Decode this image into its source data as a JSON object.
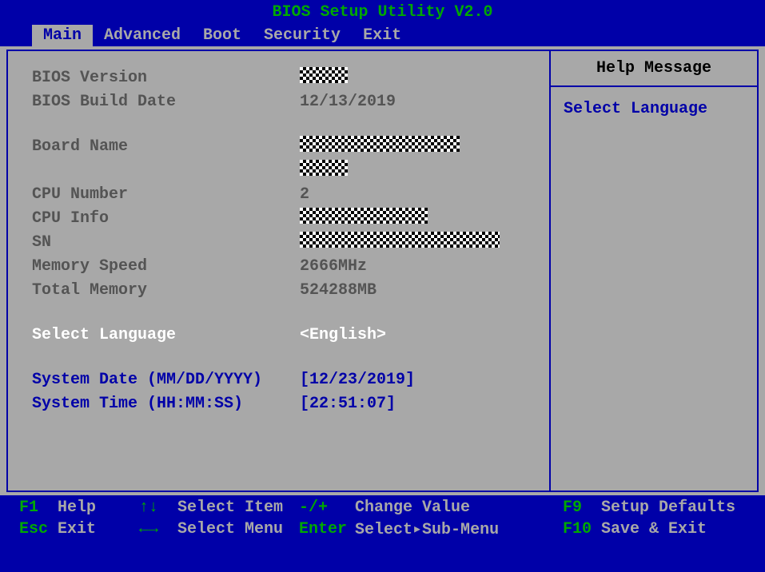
{
  "header": {
    "title": "BIOS Setup Utility V2.0"
  },
  "tabs": [
    {
      "label": "Main",
      "active": true
    },
    {
      "label": "Advanced",
      "active": false
    },
    {
      "label": "Boot",
      "active": false
    },
    {
      "label": "Security",
      "active": false
    },
    {
      "label": "Exit",
      "active": false
    }
  ],
  "main": {
    "bios_version_label": "BIOS Version",
    "bios_build_date_label": "BIOS Build Date",
    "bios_build_date_value": "12/13/2019",
    "board_name_label": "Board Name",
    "cpu_number_label": "CPU Number",
    "cpu_number_value": "2",
    "cpu_info_label": "CPU Info",
    "sn_label": "SN",
    "memory_speed_label": "Memory Speed",
    "memory_speed_value": "2666MHz",
    "total_memory_label": "Total Memory",
    "total_memory_value": "524288MB",
    "select_language_label": "Select Language",
    "select_language_value": "<English>",
    "system_date_label": "System Date (MM/DD/YYYY)",
    "system_date_value": "[12/23/2019]",
    "system_time_label": "System Time (HH:MM:SS)",
    "system_time_value": "[22:51:07]"
  },
  "help": {
    "header": "Help Message",
    "body": "Select Language"
  },
  "footer": {
    "f1": "F1",
    "f1_label": "Help",
    "updown": "↑↓",
    "updown_label": "Select Item",
    "minusplus": "-/+",
    "minusplus_label": "Change Value",
    "f9": "F9",
    "f9_label": "Setup Defaults",
    "esc": "Esc",
    "esc_label": "Exit",
    "leftright": "←→",
    "leftright_label": "Select Menu",
    "enter": "Enter",
    "enter_label": "Select▸Sub-Menu",
    "f10": "F10",
    "f10_label": "Save & Exit"
  }
}
